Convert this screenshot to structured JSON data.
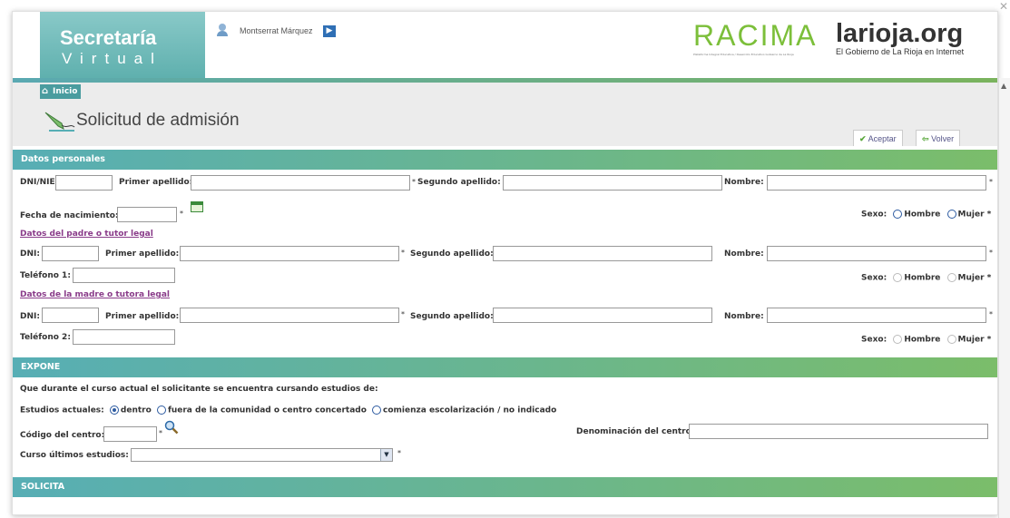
{
  "header": {
    "brand_line1": "Secretaría",
    "brand_line2": "Virtual",
    "user_name": "Montserrat Márquez",
    "racima_logo": "RACIMA",
    "racima_tagline": "Plataforma Integral Educativa / Desarrollo Educativo Gobierno de La Rioja",
    "larioja_logo": "larioja.org",
    "larioja_tagline": "El Gobierno de La Rioja en Internet"
  },
  "nav": {
    "home": "Inicio"
  },
  "page": {
    "title": "Solicitud de admisión",
    "accept": "Aceptar",
    "back": "Volver"
  },
  "datos_personales": {
    "section": "Datos personales",
    "dni": "DNI/NIE:",
    "primer_apellido": "Primer apellido:",
    "segundo_apellido": "Segundo apellido:",
    "nombre": "Nombre:",
    "fecha_nacimiento": "Fecha de nacimiento:",
    "sexo": "Sexo:",
    "hombre": "Hombre",
    "mujer": "Mujer"
  },
  "padre": {
    "link": "Datos del padre o tutor legal",
    "dni": "DNI:",
    "primer_apellido": "Primer apellido:",
    "segundo_apellido": "Segundo apellido:",
    "nombre": "Nombre:",
    "telefono": "Teléfono 1:",
    "sexo": "Sexo:",
    "hombre": "Hombre",
    "mujer": "Mujer"
  },
  "madre": {
    "link": "Datos de la madre o tutora legal",
    "dni": "DNI:",
    "primer_apellido": "Primer apellido:",
    "segundo_apellido": "Segundo apellido:",
    "nombre": "Nombre:",
    "telefono": "Teléfono 2:",
    "sexo": "Sexo:",
    "hombre": "Hombre",
    "mujer": "Mujer"
  },
  "expone": {
    "section": "EXPONE",
    "statement": "Que durante el curso actual el solicitante se encuentra cursando estudios de:",
    "estudios_label": "Estudios actuales:",
    "opt_dentro": "dentro",
    "opt_fuera": "fuera de la comunidad o centro concertado",
    "opt_comienza": "comienza escolarización / no indicado",
    "codigo_centro": "Código del centro:",
    "denominacion": "Denominación del centro:",
    "curso_ultimos": "Curso últimos estudios:"
  },
  "solicita": {
    "section": "SOLICITA"
  },
  "colors": {
    "accent_teal": "#57aeb5",
    "accent_green": "#7bbd6a",
    "link_purple": "#8a3c8a"
  }
}
